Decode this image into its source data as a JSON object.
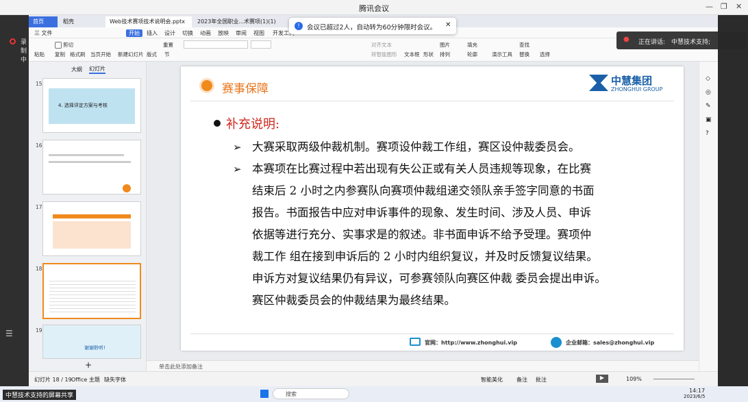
{
  "meeting": {
    "title": "腾讯会议",
    "record": "录制中",
    "speaker_label": "正在讲话:",
    "speaker_name": "中慧技术支持;",
    "notice": "会议已超过2人，自动转为60分钟限时会议。",
    "screen_share": "中慧技术支持的屏幕共享"
  },
  "tabs": [
    {
      "label": "首页"
    },
    {
      "label": "稻壳"
    },
    {
      "label": "Web技术赛项技术说明会.pptx"
    },
    {
      "label": "2023年全国职业...术赛项(1)(1)"
    }
  ],
  "menu": [
    "三 文件",
    "开始",
    "插入",
    "设计",
    "切换",
    "动画",
    "放映",
    "审阅",
    "视图",
    "开发工具"
  ],
  "ribbon": {
    "paste": "粘贴",
    "cut": "剪切",
    "copy": "复制",
    "format": "格式刷",
    "start": "当页开始",
    "newslide": "新建幻灯片",
    "layout": "版式",
    "section": "节",
    "reset": "重置",
    "align": "对齐文本",
    "convert": "转智能图形",
    "textbox": "文本框",
    "shape": "形状",
    "arrange": "排列",
    "picture": "图片",
    "fill": "填充",
    "outline": "轮廓",
    "present": "演示工具",
    "find": "查找",
    "replace": "替换",
    "select": "选择"
  },
  "panel": {
    "tab_outline": "大纲",
    "tab_slides": "幻灯片"
  },
  "thumbs": [
    {
      "num": "15",
      "text": "4. 选择评定方案与考核"
    },
    {
      "num": "16",
      "text": ""
    },
    {
      "num": "17",
      "text": ""
    },
    {
      "num": "18",
      "text": ""
    },
    {
      "num": "19",
      "text": "谢谢聆听!"
    }
  ],
  "slide": {
    "title": "赛事保障",
    "logo_cn": "中慧集团",
    "logo_en": "ZHONGHUI GROUP",
    "heading": "补充说明:",
    "lines": [
      "大赛采取两级仲裁机制。赛项设仲裁工作组，赛区设仲裁委员会。",
      "本赛项在比赛过程中若出现有失公正或有关人员违规等现象，在比赛",
      "结束后 2 小时之内参赛队向赛项仲裁组递交领队亲手签字同意的书面",
      "报告。书面报告中应对申诉事件的现象、发生时间、涉及人员、申诉",
      "依据等进行充分、实事求是的叙述。非书面申诉不给予受理。赛项仲",
      "裁工作 组在接到申诉后的 2 小时内组织复议，并及时反馈复议结果。",
      "申诉方对复议结果仍有异议，可参赛领队向赛区仲裁 委员会提出申诉。",
      "赛区仲裁委员会的仲裁结果为最终结果。"
    ],
    "site": "官网：http://www.zhonghui.vip",
    "mail": "企业邮箱：sales@zhonghui.vip"
  },
  "notes": "单击此处添加备注",
  "status": {
    "slide": "幻灯片 18 / 19",
    "theme": "Office 主题",
    "font": "缺失字体",
    "beautify": "智能美化",
    "notes": "备注",
    "comment": "批注",
    "zoom": "109%"
  },
  "taskbar": {
    "search": "搜索",
    "time": "14:17",
    "date": "2023/6/5"
  }
}
